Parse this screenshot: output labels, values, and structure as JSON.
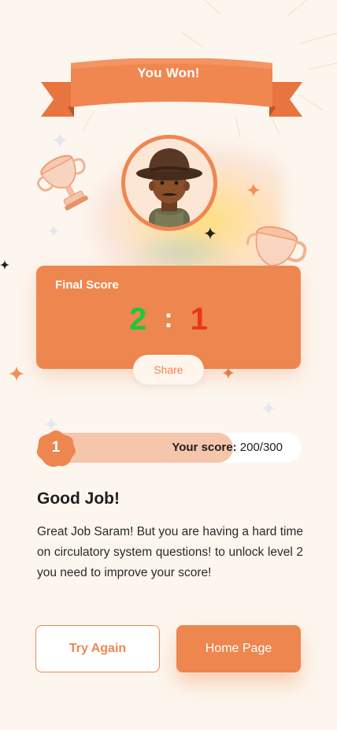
{
  "banner": {
    "title": "You Won!"
  },
  "avatar": {
    "icon": "cowboy-avatar-icon"
  },
  "score_card": {
    "label": "Final Score",
    "home_score": "2",
    "separator": ":",
    "away_score": "1",
    "share_label": "Share"
  },
  "progress": {
    "level": "1",
    "label": "Your score:",
    "value_text": "200/300",
    "score": 200,
    "max": 300
  },
  "result": {
    "heading": "Good Job!",
    "message": "Great Job Saram! But you are having a hard time on circulatory system questions! to unlock level 2 you need to improve your score!"
  },
  "actions": {
    "try_again_label": "Try Again",
    "home_label": "Home Page"
  },
  "colors": {
    "accent": "#EE864F",
    "background": "#FDF6EE",
    "home_score": "#17C93B",
    "away_score": "#E8361C",
    "progress_fill": "#F5C6AB"
  }
}
